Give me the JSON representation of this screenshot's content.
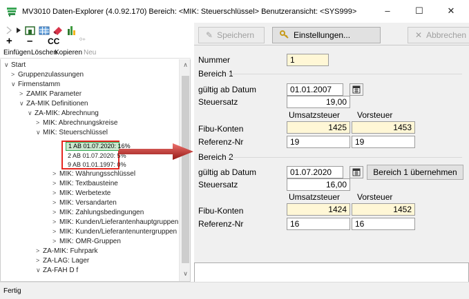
{
  "window": {
    "title": "MV3010 Daten-Explorer (4.0.92.170)  Bereich: <MIK: Steuerschlüssel>   Benutzeransicht: <SYS999>",
    "controls": [
      "–",
      "☐",
      "✕"
    ]
  },
  "left_toolbar": {
    "symbols": {
      "add": "+",
      "remove": "–",
      "copy": "CC",
      "new": "⁰⁺"
    },
    "labels": {
      "add": "Einfügen",
      "remove": "Löschen",
      "copy": "Kopieren",
      "new": "Neu"
    }
  },
  "tree": {
    "nodes": [
      {
        "twist": "∨",
        "label": "Start"
      },
      {
        "twist": ">",
        "label": "Gruppenzulassungen"
      },
      {
        "twist": "∨",
        "label": "Firmenstamm"
      },
      {
        "twist": ">",
        "label": "ZAMIK Parameter"
      },
      {
        "twist": "∨",
        "label": "ZA-MIK Definitionen"
      },
      {
        "twist": "∨",
        "label": "ZA-MIK: Abrechnung"
      },
      {
        "twist": ">",
        "label": "MIK: Abrechnungskreise"
      },
      {
        "twist": "∨",
        "label": "MIK: Steuerschlüssel"
      },
      {
        "twist": "",
        "label": "1 AB 01.07.2020: 16%"
      },
      {
        "twist": "",
        "label": "2 AB 01.07.2020: 5%"
      },
      {
        "twist": "",
        "label": "9 AB 01.01.1997: 0%"
      },
      {
        "twist": ">",
        "label": "MIK: Währungsschlüssel"
      },
      {
        "twist": ">",
        "label": "MIK: Textbausteine"
      },
      {
        "twist": ">",
        "label": "MIK: Werbetexte"
      },
      {
        "twist": ">",
        "label": "MIK: Versandarten"
      },
      {
        "twist": ">",
        "label": "MIK: Zahlungsbedingungen"
      },
      {
        "twist": ">",
        "label": "MIK: Kunden/Lieferantenhauptgruppen"
      },
      {
        "twist": ">",
        "label": "MIK: Kunden/Lieferantenuntergruppen"
      },
      {
        "twist": ">",
        "label": "MIK: OMR-Gruppen"
      },
      {
        "twist": ">",
        "label": "ZA-MIK: Fuhrpark"
      },
      {
        "twist": ">",
        "label": "ZA-LAG: Lager"
      },
      {
        "twist": "∨",
        "label": "ZA-FAH D f"
      }
    ]
  },
  "status": {
    "text": "Fertig"
  },
  "right_toolbar": {
    "save": "Speichern",
    "settings": "Einstellungen...",
    "cancel": "Abbrechen"
  },
  "form": {
    "nummer_label": "Nummer",
    "nummer_value": "1",
    "bereich1": {
      "title": "Bereich 1",
      "gueltig_label": "gültig ab Datum",
      "date": "01.01.2007",
      "steuersatz_label": "Steuersatz",
      "steuersatz": "19,00",
      "col_umsatz": "Umsatzsteuer",
      "col_vorsteuer": "Vorsteuer",
      "fibu_label": "Fibu-Konten",
      "fibu_umsatz": "1425",
      "fibu_vorsteuer": "1453",
      "ref_label": "Referenz-Nr",
      "ref_umsatz": "19",
      "ref_vorsteuer": "19"
    },
    "bereich2": {
      "title": "Bereich 2",
      "gueltig_label": "gültig ab Datum",
      "date": "01.07.2020",
      "copy_button": "Bereich 1 übernehmen",
      "steuersatz_label": "Steuersatz",
      "steuersatz": "16,00",
      "col_umsatz": "Umsatzsteuer",
      "col_vorsteuer": "Vorsteuer",
      "fibu_label": "Fibu-Konten",
      "fibu_umsatz": "1424",
      "fibu_vorsteuer": "1452",
      "ref_label": "Referenz-Nr",
      "ref_umsatz": "16",
      "ref_vorsteuer": "16"
    }
  },
  "colors": {
    "highlight_red": "#e52620",
    "selection_green": "#cbe7cf",
    "field_yellow": "#fff7d6",
    "app_icon": "#3aa655"
  },
  "icons": [
    "app-icon",
    "arrow-right-icon",
    "home-icon",
    "grid-icon",
    "eraser-icon",
    "column-chart-icon",
    "pencil-icon",
    "key-icon",
    "calendar-icon",
    "cross-icon"
  ]
}
